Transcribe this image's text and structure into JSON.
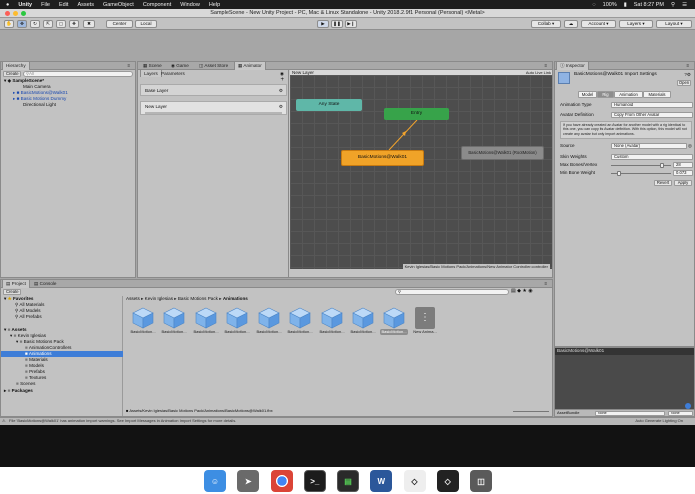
{
  "menubar": {
    "apple": "",
    "app": "Unity",
    "items": [
      "File",
      "Edit",
      "Assets",
      "GameObject",
      "Component",
      "Window",
      "Help"
    ],
    "status": {
      "battery": "100%",
      "clock": "Sat 8:27 PM"
    }
  },
  "window": {
    "title": "SampleScene - New Unity Project - PC, Mac & Linux Standalone - Unity 2018.2.9f1 Personal (Personal) <Metal>"
  },
  "toolbar": {
    "center": "Center",
    "local": "Local",
    "collab": "Collab",
    "account": "Account",
    "layers": "Layers",
    "layout": "Layout"
  },
  "hierarchy": {
    "tab": "Hierarchy",
    "create": "Create",
    "search_placeholder": "All",
    "scene": "SampleScene*",
    "items": [
      "Main Camera",
      "BasicMotions@Walk01",
      "Basic Motions Dummy",
      "Directional Light"
    ]
  },
  "animator": {
    "tabs": [
      "Scene",
      "Game",
      "Asset Store",
      "Animator"
    ],
    "sub_tabs": [
      "Layers",
      "Parameters"
    ],
    "base_layer": "Base Layer",
    "layer_name": "New Layer",
    "breadcrumb": "New Layer",
    "auto_live_link": "Auto Live Link",
    "states": {
      "any": "Any State",
      "entry": "Entry",
      "walk": "BasicMotions@Walk01",
      "blend": "BasicMotions@Walk01 (RootMotion)"
    },
    "footer_path": "Kevin Iglesias/Basic Motions Pack/Animations/New Animator Controller.controller"
  },
  "inspector": {
    "tab": "Inspector",
    "title": "BasicMotions@Walk01 Import Settings",
    "open": "Open",
    "tabs": [
      "Model",
      "Rig",
      "Animation",
      "Materials"
    ],
    "fields": [
      {
        "label": "Animation Type",
        "value": "Humanoid"
      },
      {
        "label": "Avatar Definition",
        "value": "Copy From Other Avatar"
      }
    ],
    "info": "If you have already created an Avatar for another model with a rig identical to this one, you can copy its Avatar definition. With this option, this model will not create any avatar but only import animations.",
    "source_label": "Source",
    "source_value": "None (Avatar)",
    "skin_label": "Skin Weights",
    "skin_value": "Custom",
    "max_bones_label": "Max Bones/Vertex",
    "max_bones_value": "28",
    "max_bones_level": 0.88,
    "min_weight_label": "Min Bone Weight",
    "min_weight_value": "0.073",
    "min_weight_level": 0.1,
    "revert": "Revert",
    "apply": "Apply",
    "preview_title": "BasicMotions@Walk01",
    "assetbundle_label": "AssetBundle",
    "assetbundle_value": "None",
    "assetbundle_variant": "None"
  },
  "project": {
    "tabs": [
      "Project",
      "Console"
    ],
    "create": "Create",
    "favorites": "Favorites",
    "fav_items": [
      "All Materials",
      "All Models",
      "All Prefabs"
    ],
    "assets": "Assets",
    "tree": [
      "Kevin Iglesias",
      "Basic Motions Pack",
      "AnimationControllers",
      "Animations",
      "Materials",
      "Models",
      "Prefabs",
      "Textures",
      "Scenes"
    ],
    "packages": "Packages",
    "breadcrumb": [
      "Assets",
      "Kevin Iglesias",
      "Basic Motions Pack",
      "Animations"
    ],
    "tiles": [
      "BasicMotion...",
      "BasicMotion...",
      "BasicMotion...",
      "BasicMotion...",
      "BasicMotion...",
      "BasicMotion...",
      "BasicMotion...",
      "BasicMotion...",
      "BasicMotion...",
      "New Anima..."
    ],
    "path": "Assets/Kevin Iglesias/Basic Motions Pack/Animations/BasicMotions@Walk01.fbx"
  },
  "statusbar": {
    "warning": "File 'BasicMotions@Walk01' has animation import warnings. See Import Messages in Animation Import Settings for more details.",
    "right": "Auto Generate Lighting On"
  },
  "dock": [
    "finder-icon",
    "launchpad-icon",
    "chrome-icon",
    "terminal-icon",
    "activity-icon",
    "word-icon",
    "unity-icon",
    "unity-hub-icon",
    "trash-icon"
  ],
  "colors": {
    "state_any": "#5fb7a8",
    "state_entry": "#37a34a",
    "state_default": "#f0a328",
    "state_gray": "#8b8b8b",
    "selection": "#3e7dd7",
    "transition": "#f3a42c"
  }
}
